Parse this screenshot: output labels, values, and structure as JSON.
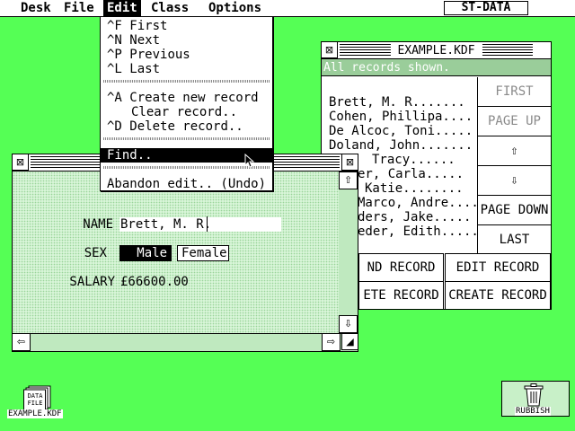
{
  "menubar": {
    "items": [
      "Desk",
      "File",
      "Edit",
      "Class",
      "Options"
    ],
    "app_title": "ST-DATA"
  },
  "edit_menu": {
    "items": [
      {
        "shortcut": "^F",
        "label": "First"
      },
      {
        "shortcut": "^N",
        "label": "Next"
      },
      {
        "shortcut": "^P",
        "label": "Previous"
      },
      {
        "shortcut": "^L",
        "label": "Last"
      },
      {
        "shortcut": "^A",
        "label": "Create new record"
      },
      {
        "shortcut": "",
        "label": "Clear record.."
      },
      {
        "shortcut": "^D",
        "label": "Delete record.."
      },
      {
        "shortcut": "",
        "label": "Find.."
      },
      {
        "shortcut": "",
        "label": "Abandon edit.. (Undo)"
      }
    ]
  },
  "form_window": {
    "fields": {
      "name_label": "NAME",
      "name_value": "Brett, M. R.",
      "sex_label": "SEX",
      "sex_options": [
        "Male",
        "Female"
      ],
      "sex_selected": "Male",
      "salary_label": "SALARY",
      "salary_value": "£66600.00"
    }
  },
  "kdf_window": {
    "title": "EXAMPLE.KDF",
    "status": "All records shown.",
    "records": [
      "Brett, M. R.......",
      "Cohen, Phillipa....",
      "De Alcoc, Toni.....",
      "Doland, John.......",
      "Tracy......",
      "er, Carla.....",
      "Katie........",
      "Marco, Andre....",
      "ders, Jake.....",
      "eder, Edith....."
    ],
    "nav_buttons": [
      {
        "label": "FIRST",
        "enabled": false
      },
      {
        "label": "PAGE UP",
        "enabled": false
      },
      {
        "label": "⇧",
        "enabled": true
      },
      {
        "label": "⇩",
        "enabled": true
      },
      {
        "label": "PAGE DOWN",
        "enabled": true
      },
      {
        "label": "LAST",
        "enabled": true
      }
    ],
    "action_buttons": [
      "ND RECORD",
      "EDIT RECORD",
      "ETE RECORD",
      "CREATE RECORD"
    ]
  },
  "desktop": {
    "file_icon_label": "EXAMPLE.KDF",
    "file_icon_text": [
      "DATA",
      "FILE"
    ],
    "trash_label": "RUBBISH"
  },
  "colors": {
    "desktop": "#55ff55",
    "status_bar": "#9acd9a"
  }
}
